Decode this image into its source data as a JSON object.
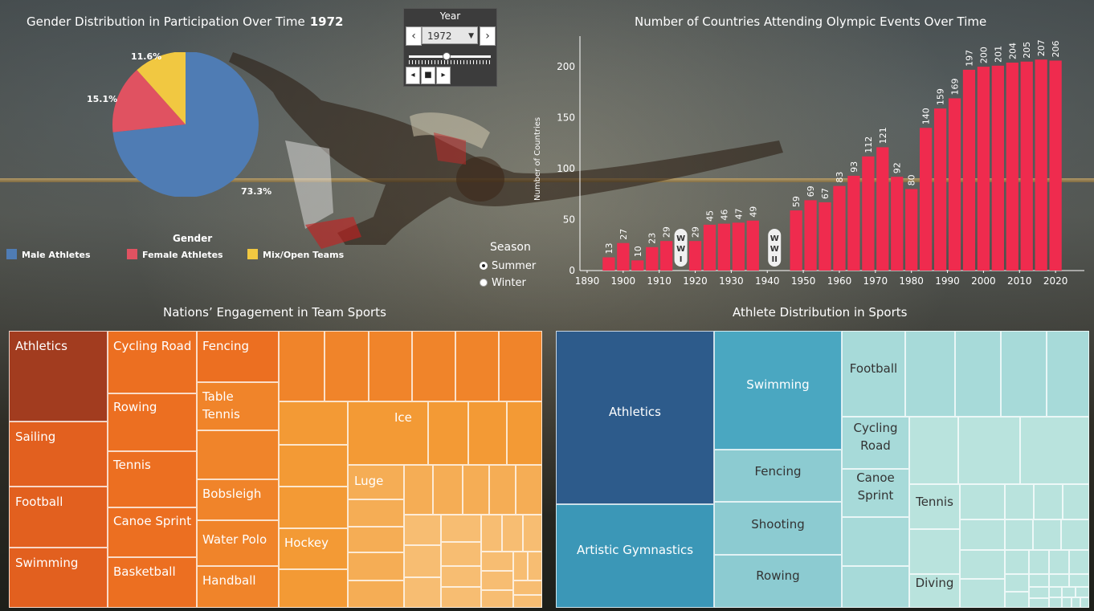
{
  "pie": {
    "title": "Gender Distribution in Participation Over Time",
    "year": "1972",
    "legend_title": "Gender",
    "slices": [
      {
        "label": "Male Athletes",
        "value": 73.3,
        "text": "73.3%",
        "color": "#4f7cb4"
      },
      {
        "label": "Female Athletes",
        "value": 15.1,
        "text": "15.1%",
        "color": "#e05261"
      },
      {
        "label": "Mix/Open Teams",
        "value": 11.6,
        "text": "11.6%",
        "color": "#f1c841"
      }
    ]
  },
  "year_control": {
    "label": "Year",
    "selected": "1972",
    "prev_icon": "‹",
    "next_icon": "›",
    "slider_value_fraction": 0.45,
    "play_icons": [
      "◂",
      "■",
      "▸"
    ]
  },
  "season": {
    "title": "Season",
    "options": [
      "Summer",
      "Winter"
    ],
    "selected": "Summer"
  },
  "bar_chart": {
    "title": "Number of Countries Attending Olympic Events Over Time",
    "ylabel": "Number of Countries",
    "bar_color": "#ef2b4e"
  },
  "chart_data": [
    {
      "type": "pie",
      "title": "Gender Distribution in Participation Over Time",
      "categories": [
        "Male Athletes",
        "Female Athletes",
        "Mix/Open Teams"
      ],
      "values": [
        73.3,
        15.1,
        11.6
      ]
    },
    {
      "type": "bar",
      "title": "Number of Countries Attending Olympic Events Over Time",
      "xlabel": "",
      "ylabel": "Number of Countries",
      "ylim": [
        0,
        230
      ],
      "xlim": [
        1888,
        2028
      ],
      "yticks": [
        0,
        50,
        100,
        150,
        200
      ],
      "xticks": [
        1890,
        1900,
        1910,
        1920,
        1930,
        1940,
        1950,
        1960,
        1970,
        1980,
        1990,
        2000,
        2010,
        2020
      ],
      "x": [
        1896,
        1900,
        1904,
        1908,
        1912,
        1920,
        1924,
        1928,
        1932,
        1936,
        1948,
        1952,
        1956,
        1960,
        1964,
        1968,
        1972,
        1976,
        1980,
        1984,
        1988,
        1992,
        1996,
        2000,
        2004,
        2008,
        2012,
        2016,
        2020
      ],
      "values": [
        13,
        27,
        10,
        23,
        29,
        29,
        45,
        46,
        47,
        49,
        59,
        69,
        67,
        83,
        93,
        112,
        121,
        92,
        80,
        140,
        159,
        169,
        197,
        200,
        201,
        204,
        205,
        207,
        206
      ],
      "annotations": [
        {
          "text": "WWI",
          "x": 1916
        },
        {
          "text": "WWII",
          "x": 1942
        }
      ]
    }
  ],
  "team_treemap": {
    "title": "Nations’ Engagement in Team Sports",
    "labels": [
      "Athletics",
      "Sailing",
      "Football",
      "Swimming",
      "Cycling Road",
      "Rowing",
      "Tennis",
      "Canoe Sprint",
      "Basketball",
      "Fencing",
      "Table\nTennis",
      "Bobsleigh",
      "Water Polo",
      "Handball",
      "Ice",
      "Luge",
      "Hockey"
    ]
  },
  "athlete_treemap": {
    "title": "Athlete Distribution in Sports",
    "labels": [
      "Athletics",
      "Artistic Gymnastics",
      "Swimming",
      "Fencing",
      "Shooting",
      "Rowing",
      "Football",
      "Cycling\nRoad",
      "Canoe\nSprint",
      "Tennis",
      "Diving"
    ]
  }
}
